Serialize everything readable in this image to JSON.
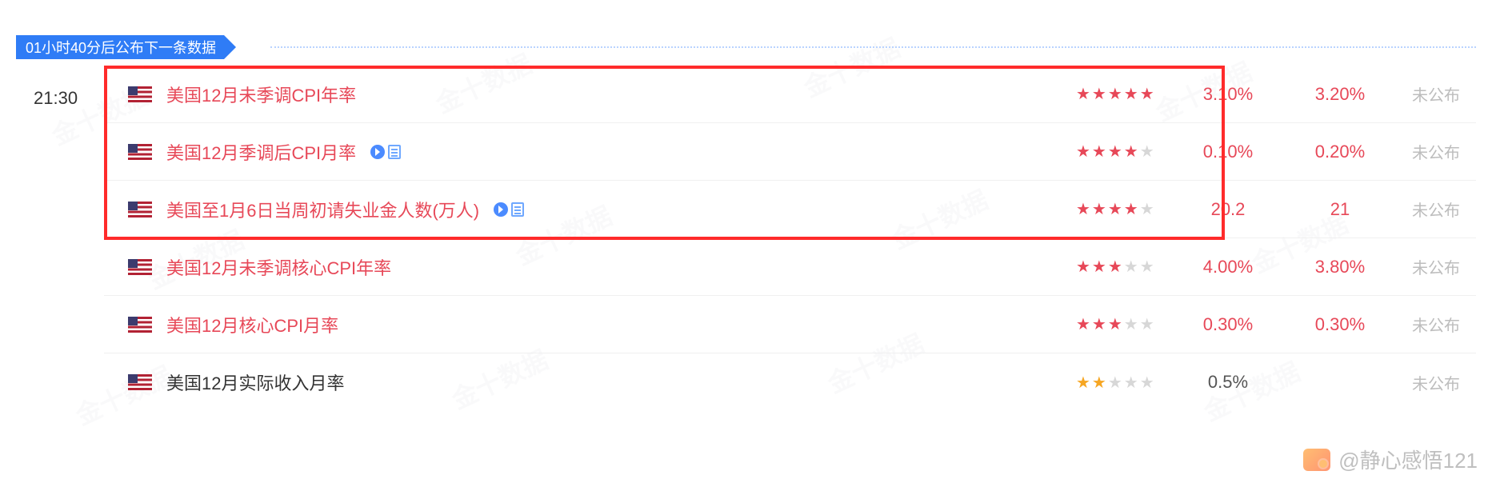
{
  "banner": "01小时40分后公布下一条数据",
  "time": "21:30",
  "rows": [
    {
      "title": "美国12月未季调CPI年率",
      "stars": 5,
      "col1": "3.10%",
      "col2": "3.20%",
      "status": "未公布",
      "highlight": true,
      "extras": false
    },
    {
      "title": "美国12月季调后CPI月率",
      "stars": 4,
      "col1": "0.10%",
      "col2": "0.20%",
      "status": "未公布",
      "highlight": true,
      "extras": true
    },
    {
      "title": "美国至1月6日当周初请失业金人数(万人)",
      "stars": 4,
      "col1": "20.2",
      "col2": "21",
      "status": "未公布",
      "highlight": true,
      "extras": true
    },
    {
      "title": "美国12月未季调核心CPI年率",
      "stars": 3,
      "col1": "4.00%",
      "col2": "3.80%",
      "status": "未公布",
      "highlight": true,
      "extras": false
    },
    {
      "title": "美国12月核心CPI月率",
      "stars": 3,
      "col1": "0.30%",
      "col2": "0.30%",
      "status": "未公布",
      "highlight": true,
      "extras": false
    },
    {
      "title": "美国12月实际收入月率",
      "stars": 2,
      "col1": "0.5%",
      "col2": "",
      "status": "未公布",
      "highlight": false,
      "extras": false,
      "gold": true
    }
  ],
  "author": {
    "at": "@静心感悟121"
  }
}
